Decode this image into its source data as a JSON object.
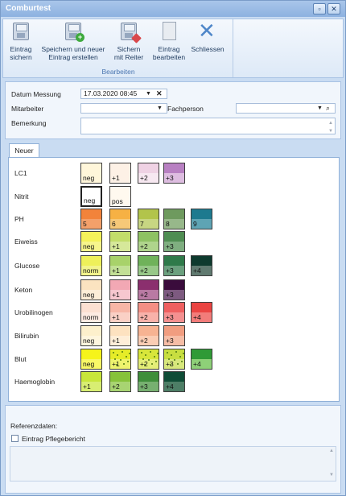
{
  "window": {
    "title": "Comburtest",
    "minimize": "▫",
    "close": "✕"
  },
  "ribbon": {
    "group_label": "Bearbeiten",
    "buttons": [
      {
        "label": "Eintrag\nsichern",
        "icon": "save-icon"
      },
      {
        "label": "Speichern und neuer\nEintrag erstellen",
        "icon": "save-new-icon"
      },
      {
        "label": "Sichern\nmit Reiter",
        "icon": "save-tab-icon"
      },
      {
        "label": "Eintrag\nbearbeiten",
        "icon": "edit-icon"
      },
      {
        "label": "Schliessen",
        "icon": "close-icon"
      }
    ]
  },
  "form": {
    "datum_label": "Datum Messung",
    "datum_value": "17.03.2020 08:45",
    "mitarbeiter_label": "Mitarbeiter",
    "mitarbeiter_value": "",
    "fachperson_label": "Fachperson",
    "fachperson_value": "",
    "bemerkung_label": "Bemerkung",
    "bemerkung_value": ""
  },
  "tabs": {
    "active": "Neuer"
  },
  "test_rows": [
    {
      "label": "LC1",
      "swatches": [
        {
          "text": "neg",
          "top": "#fff6da",
          "bot": "#fff6da"
        },
        {
          "text": "+1",
          "top": "#fdf1e6",
          "bot": "#fdf1e6"
        },
        {
          "text": "+2",
          "top": "#efd2e4",
          "bot": "#f7e8f1"
        },
        {
          "text": "+3",
          "top": "#b880c2",
          "bot": "#ddbde0"
        }
      ]
    },
    {
      "label": "Nitrit",
      "swatches": [
        {
          "text": "neg",
          "top": "#ffffff",
          "bot": "#ffffff",
          "thick": true
        },
        {
          "text": "pos",
          "top": "#fff9ef",
          "bot": "#fff9ef"
        }
      ]
    },
    {
      "label": "PH",
      "swatches": [
        {
          "text": "5",
          "top": "#f2833a",
          "bot": "#f3a06a"
        },
        {
          "text": "6",
          "top": "#f6b144",
          "bot": "#f6c878"
        },
        {
          "text": "7",
          "top": "#b2c44b",
          "bot": "#c8d682"
        },
        {
          "text": "8",
          "top": "#6e9a5e",
          "bot": "#97b88a"
        },
        {
          "text": "9",
          "top": "#1d7a8f",
          "bot": "#5ea4b4"
        }
      ]
    },
    {
      "label": "Eiweiss",
      "swatches": [
        {
          "text": "neg",
          "top": "#f4f25a",
          "bot": "#f7f58c"
        },
        {
          "text": "+1",
          "top": "#c2dd6a",
          "bot": "#d6e89a"
        },
        {
          "text": "+2",
          "top": "#8ec263",
          "bot": "#afd48c"
        },
        {
          "text": "+3",
          "top": "#4f8d52",
          "bot": "#7fae80"
        }
      ]
    },
    {
      "label": "Glucose",
      "swatches": [
        {
          "text": "norm",
          "top": "#eef05a",
          "bot": "#f3f48c"
        },
        {
          "text": "+1",
          "top": "#a8d26a",
          "bot": "#c2e096"
        },
        {
          "text": "+2",
          "top": "#6fb25a",
          "bot": "#97c888"
        },
        {
          "text": "+3",
          "top": "#2f7a4a",
          "bot": "#6ba07e"
        },
        {
          "text": "+4",
          "top": "#0e3a2e",
          "bot": "#607a70"
        }
      ]
    },
    {
      "label": "Keton",
      "swatches": [
        {
          "text": "neg",
          "top": "#fbe3c0",
          "bot": "#fdeed8"
        },
        {
          "text": "+1",
          "top": "#f2a8b4",
          "bot": "#f7c7cf"
        },
        {
          "text": "+2",
          "top": "#8b2f6e",
          "bot": "#b97aa3"
        },
        {
          "text": "+3",
          "top": "#3a0c3c",
          "bot": "#7d5a80"
        }
      ]
    },
    {
      "label": "Urobilinogen",
      "swatches": [
        {
          "text": "norm",
          "top": "#fce0d2",
          "bot": "#fdebe2"
        },
        {
          "text": "+1",
          "top": "#f7b6a6",
          "bot": "#fad0c5"
        },
        {
          "text": "+2",
          "top": "#f48f84",
          "bot": "#f8b2aa"
        },
        {
          "text": "+3",
          "top": "#ef6060",
          "bot": "#f49090"
        },
        {
          "text": "+4",
          "top": "#ea4442",
          "bot": "#f27c7a"
        }
      ]
    },
    {
      "label": "Bilirubin",
      "swatches": [
        {
          "text": "neg",
          "top": "#fdf0cc",
          "bot": "#fef6de"
        },
        {
          "text": "+1",
          "top": "#fde2c0",
          "bot": "#feeed8"
        },
        {
          "text": "+2",
          "top": "#f7b392",
          "bot": "#fbcdb4"
        },
        {
          "text": "+3",
          "top": "#f19d80",
          "bot": "#f6bda6"
        }
      ]
    },
    {
      "label": "Blut",
      "swatches": [
        {
          "text": "neg",
          "top": "#f6f41a",
          "bot": "#f9f866"
        },
        {
          "text": "+1",
          "top": "#e6ec28",
          "bot": "#eef36e",
          "specks": true
        },
        {
          "text": "+2",
          "top": "#d8e63a",
          "bot": "#e4ee78",
          "specks": true
        },
        {
          "text": "+3",
          "top": "#c8de40",
          "bot": "#d8e87c",
          "specks": true
        },
        {
          "text": "+4",
          "top": "#2f9a36",
          "bot": "#8ed078"
        }
      ]
    },
    {
      "label": "Haemoglobin",
      "swatches": [
        {
          "text": "+1",
          "top": "#c8e63a",
          "bot": "#d8ee72"
        },
        {
          "text": "+2",
          "top": "#86c23a",
          "bot": "#a8d472"
        },
        {
          "text": "+3",
          "top": "#3f8e3a",
          "bot": "#77b070"
        },
        {
          "text": "+4",
          "top": "#0f4c36",
          "bot": "#4d7e66"
        }
      ]
    }
  ],
  "footer": {
    "referenz_label": "Referenzdaten:",
    "pflegebericht_label": "Eintrag Pflegebericht",
    "pflegebericht_checked": false
  }
}
